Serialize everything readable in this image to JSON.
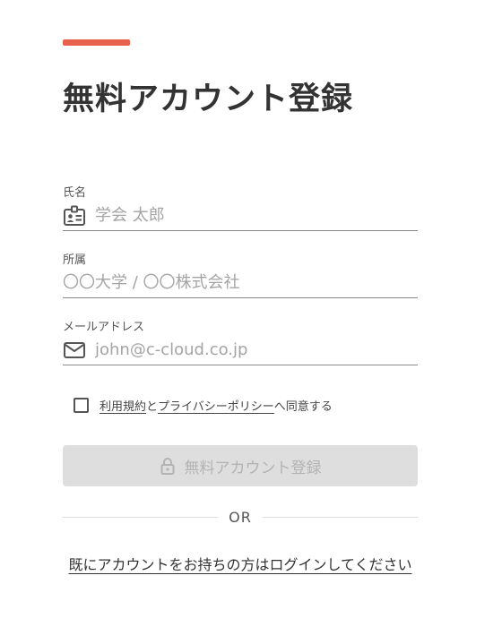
{
  "colors": {
    "accent": "#e8604c",
    "button_disabled_bg": "#dedede",
    "button_disabled_text": "#b3b3b3"
  },
  "page": {
    "title": "無料アカウント登録"
  },
  "form": {
    "name": {
      "label": "氏名",
      "placeholder": "学会 太郎",
      "icon": "id-badge-icon"
    },
    "affiliation": {
      "label": "所属",
      "placeholder": "〇〇大学 / 〇〇株式会社"
    },
    "email": {
      "label": "メールアドレス",
      "placeholder": "john@c-cloud.co.jp",
      "icon": "mail-icon"
    }
  },
  "agreement": {
    "terms_link": "利用規約",
    "and": "と",
    "privacy_link": "プライバシーポリシー",
    "suffix": "へ同意する",
    "checked": false
  },
  "submit": {
    "label": "無料アカウント登録",
    "icon": "lock-icon",
    "disabled": true
  },
  "divider": {
    "label": "OR"
  },
  "login": {
    "label": "既にアカウントをお持ちの方はログインしてください"
  }
}
